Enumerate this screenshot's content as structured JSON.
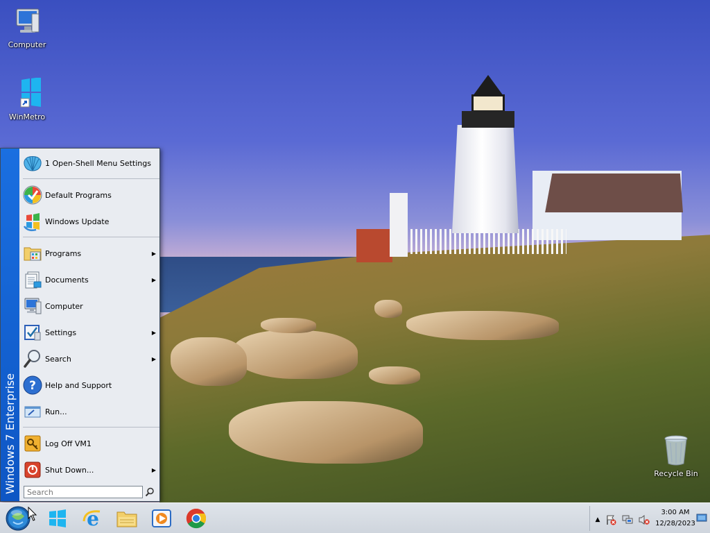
{
  "desktop": {
    "icons": [
      {
        "label": "Computer"
      },
      {
        "label": "WinMetro"
      },
      {
        "label": "Recycle Bin"
      }
    ]
  },
  "start_menu": {
    "banner": "Windows 7 Enterprise",
    "items": [
      {
        "label": "1 Open-Shell Menu Settings",
        "icon": "shell-icon",
        "submenu": false
      },
      {
        "label": "Default Programs",
        "icon": "default-programs-icon",
        "submenu": false
      },
      {
        "label": "Windows Update",
        "icon": "windows-update-icon",
        "submenu": false
      },
      {
        "label": "Programs",
        "icon": "programs-icon",
        "submenu": true
      },
      {
        "label": "Documents",
        "icon": "documents-icon",
        "submenu": true
      },
      {
        "label": "Computer",
        "icon": "computer-icon",
        "submenu": false
      },
      {
        "label": "Settings",
        "icon": "settings-icon",
        "submenu": true
      },
      {
        "label": "Search",
        "icon": "search-icon",
        "submenu": true
      },
      {
        "label": "Help and Support",
        "icon": "help-icon",
        "submenu": false
      },
      {
        "label": "Run...",
        "icon": "run-icon",
        "submenu": false
      },
      {
        "label": "Log Off VM1",
        "icon": "log-off-icon",
        "submenu": false
      },
      {
        "label": "Shut Down...",
        "icon": "shut-down-icon",
        "submenu": true
      }
    ],
    "search_placeholder": "Search"
  },
  "taskbar": {
    "pinned": [
      {
        "name": "windows-metro-icon"
      },
      {
        "name": "internet-explorer-icon"
      },
      {
        "name": "file-explorer-icon"
      },
      {
        "name": "media-player-icon"
      },
      {
        "name": "chrome-icon"
      }
    ],
    "tray": {
      "time": "3:00 AM",
      "date": "12/28/2023"
    }
  },
  "colors": {
    "banner": "#1a6fe0",
    "menu_bg": "#e9ecf1",
    "taskbar": "#d6dbe2"
  }
}
